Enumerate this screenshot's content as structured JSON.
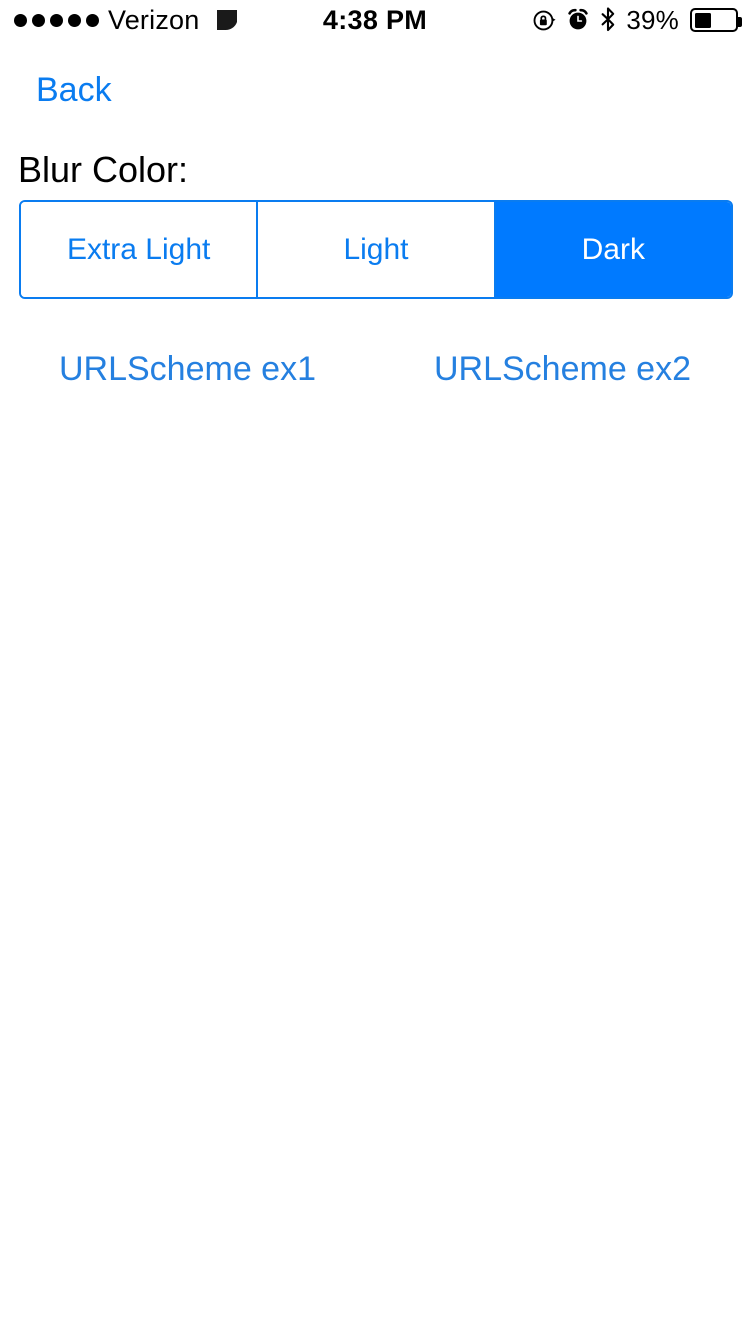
{
  "status_bar": {
    "carrier": "Verizon",
    "signal_dots": 5,
    "signal_glyph": "carrier-quarter-circle-icon",
    "time": "4:38 PM",
    "rotation_lock_icon": "rotation-lock-icon",
    "alarm_icon": "alarm-clock-icon",
    "bluetooth_icon": "bluetooth-icon",
    "battery_percent_label": "39%",
    "battery_level": 39
  },
  "navigation": {
    "back_label": "Back"
  },
  "content": {
    "section_label": "Blur Color:",
    "segmented_control": {
      "name": "blur-color-segmented-control",
      "selected_index": 2,
      "segments": [
        {
          "label": "Extra Light"
        },
        {
          "label": "Light"
        },
        {
          "label": "Dark"
        }
      ]
    },
    "links": [
      {
        "label": "URLScheme ex1"
      },
      {
        "label": "URLScheme ex2"
      }
    ]
  },
  "colors": {
    "accent_blue": "#007AFF",
    "link_blue": "#2580E0",
    "background": "#FFFFFF",
    "text_black": "#000000"
  }
}
